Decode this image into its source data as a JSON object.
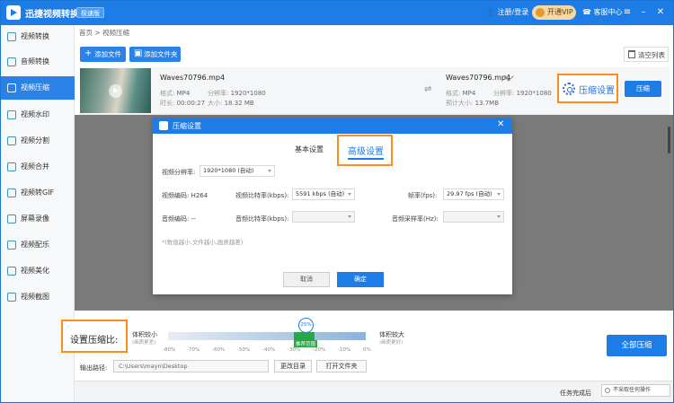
{
  "app": {
    "title": "迅捷视频转换器",
    "edition": "极速版",
    "login": "注册/登录",
    "vip": "开通VIP",
    "service": "客服中心"
  },
  "sidebar": {
    "items": [
      {
        "label": "视频转换",
        "icon": "video-convert-icon"
      },
      {
        "label": "音频转换",
        "icon": "audio-convert-icon"
      },
      {
        "label": "视频压缩",
        "icon": "video-compress-icon",
        "active": true
      },
      {
        "label": "视频水印",
        "icon": "watermark-icon"
      },
      {
        "label": "视频分割",
        "icon": "split-icon"
      },
      {
        "label": "视频合并",
        "icon": "merge-icon"
      },
      {
        "label": "视频转GIF",
        "icon": "gif-icon"
      },
      {
        "label": "屏幕录像",
        "icon": "record-icon"
      },
      {
        "label": "视频配乐",
        "icon": "music-icon"
      },
      {
        "label": "视频美化",
        "icon": "beautify-icon"
      },
      {
        "label": "视频截图",
        "icon": "screenshot-icon"
      }
    ]
  },
  "breadcrumb": "首页 > 视频压缩",
  "toolbar": {
    "add_file": "添加文件",
    "add_folder": "添加文件夹",
    "clear_list": "清空列表"
  },
  "file": {
    "name": "Waves70796.mp4",
    "format_label": "格式:",
    "format": "MP4",
    "resolution_label": "分辨率:",
    "resolution": "1920*1080",
    "duration_label": "时长:",
    "duration": "00:00:27",
    "size_label": "大小:",
    "size": "18.32 MB",
    "output_name": "Waves70796.mp4",
    "output_format": "MP4",
    "output_resolution": "1920*1080",
    "estimate_label": "预计大小:",
    "estimate": "13.7MB",
    "settings_button": "压缩设置",
    "compress_button": "压缩"
  },
  "dialog": {
    "title": "压缩设置",
    "tab_basic": "基本设置",
    "tab_advanced": "高级设置",
    "resolution_label": "视频分辨率:",
    "resolution_value": "1920*1080 (自动)",
    "video_codec_label": "视频编码: H264",
    "video_bitrate_label": "视频比特率(kbps):",
    "video_bitrate_value": "5591 kbps (自动)",
    "framerate_label": "帧率(fps):",
    "framerate_value": "29.97 fps (自动)",
    "audio_codec_label": "音频编码: --",
    "audio_bitrate_label": "音频比特率(kbps):",
    "audio_samplerate_label": "音频采样率(Hz):",
    "note": "*(数值越小,文件越小,画质越差)",
    "cancel": "取消",
    "ok": "确定"
  },
  "compression": {
    "label": "设置压缩比:",
    "left_label": "体积较小",
    "left_sub": "(画质更差)",
    "right_label": "体积较大",
    "right_sub": "(画质更好)",
    "value": "25%",
    "recommend": "推荐范围",
    "ticks": [
      "-80%",
      "-70%",
      "-60%",
      "-50%",
      "-40%",
      "-30%",
      "-20%",
      "-10%",
      "0%"
    ],
    "all_button": "全部压缩"
  },
  "output": {
    "label": "输出路径:",
    "path": "C:\\Users\\mayn\\Desktop",
    "change_dir": "更改目录",
    "open_folder": "打开文件夹"
  },
  "status": {
    "after_label": "任务完成后",
    "after_value": "不采取任何操作"
  }
}
